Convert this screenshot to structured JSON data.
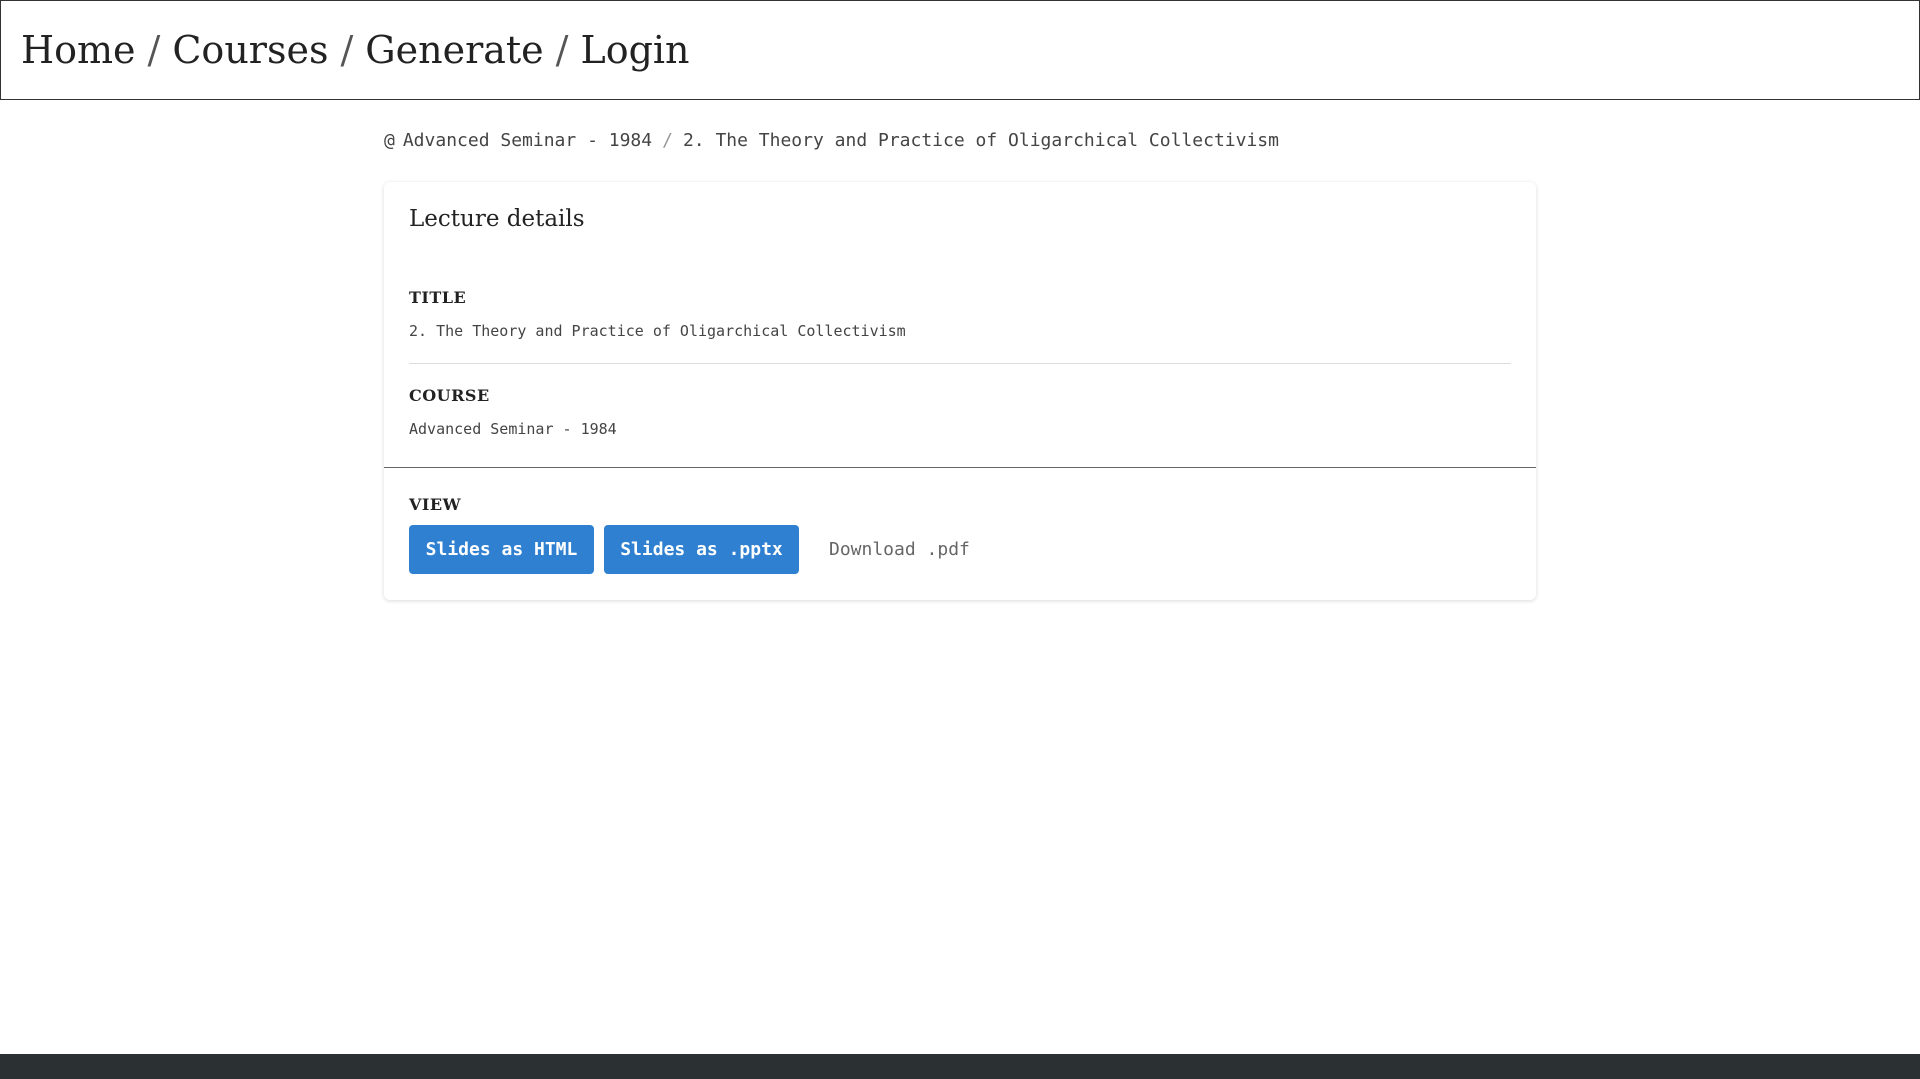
{
  "nav": {
    "items": [
      "Home",
      "Courses",
      "Generate",
      "Login"
    ],
    "separator": "/"
  },
  "breadcrumb": {
    "prefix": "@",
    "course": "Advanced Seminar - 1984",
    "separator": "/",
    "lecture": "2. The Theory and Practice of Oligarchical Collectivism"
  },
  "card": {
    "title": "Lecture details",
    "fields": [
      {
        "label": "TITLE",
        "value": "2. The Theory and Practice of Oligarchical Collectivism"
      },
      {
        "label": "COURSE",
        "value": "Advanced Seminar - 1984"
      }
    ],
    "view": {
      "label": "VIEW",
      "html_button": "Slides as HTML",
      "pptx_button": "Slides as .pptx",
      "pdf_link": "Download .pdf"
    }
  },
  "colors": {
    "accent": "#2f80d1",
    "footer": "#2b3133"
  }
}
